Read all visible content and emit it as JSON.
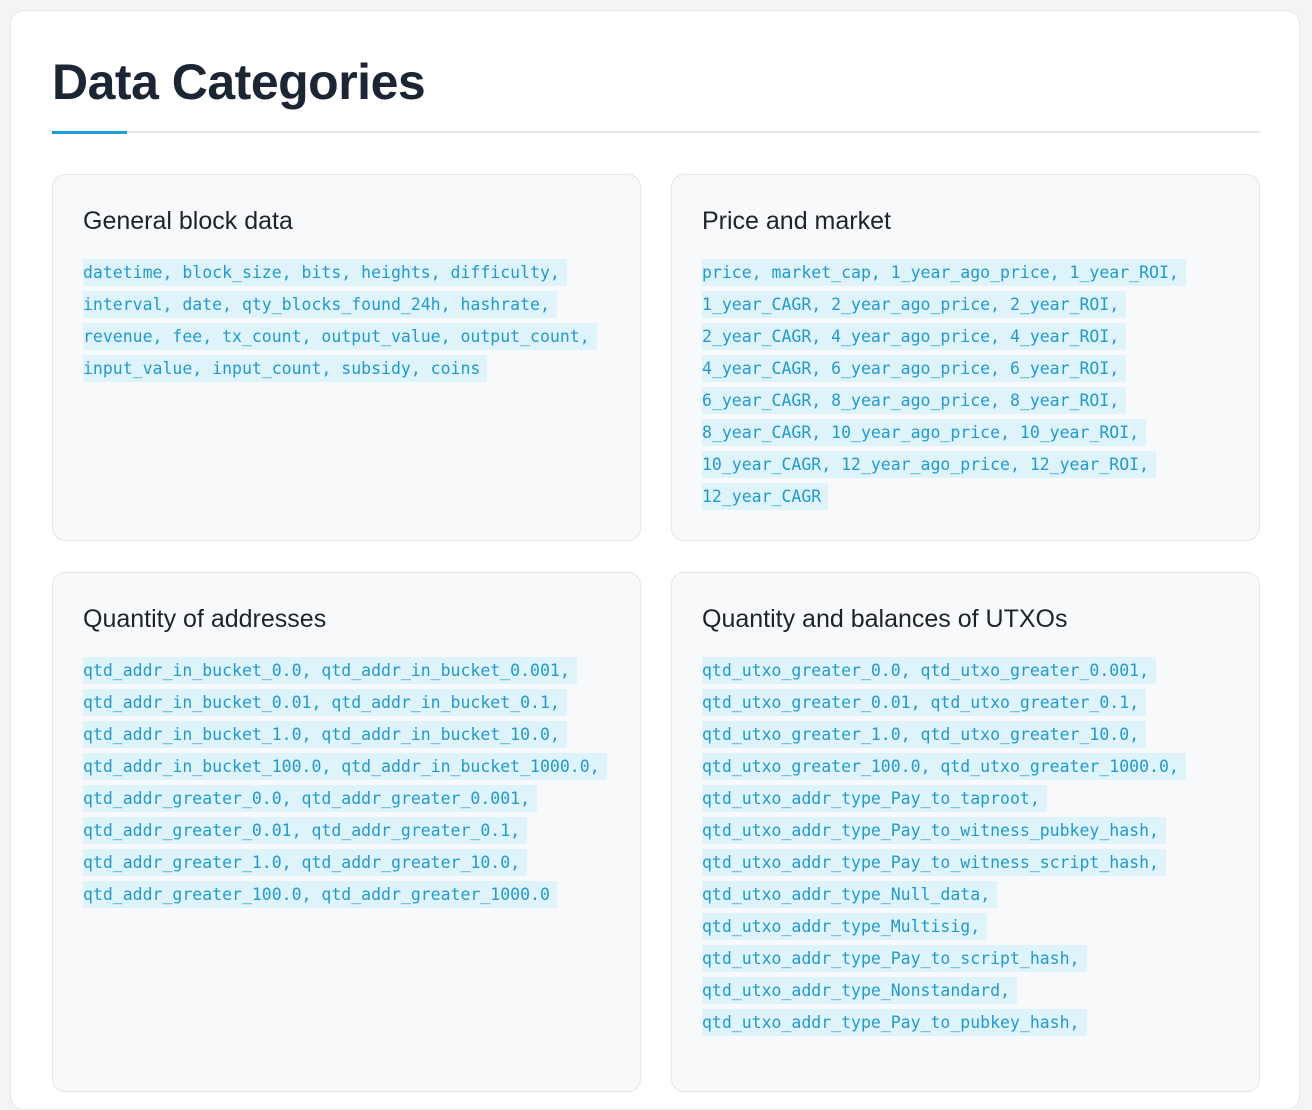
{
  "page": {
    "title": "Data Categories",
    "accent_color": "#1a9fde",
    "code_text_color": "#1f9bd0",
    "code_bg_color": "#def3fa"
  },
  "categories": [
    {
      "title": "General block data",
      "fields": " datetime, block_size, bits, heights, difficulty, interval, date, qty_blocks_found_24h, hashrate, revenue, fee, tx_count, output_value, output_count, input_value, input_count, subsidy, coins"
    },
    {
      "title": "Price and market",
      "fields": " price, market_cap, 1_year_ago_price, 1_year_ROI, 1_year_CAGR, 2_year_ago_price, 2_year_ROI, 2_year_CAGR, 4_year_ago_price, 4_year_ROI, 4_year_CAGR, 6_year_ago_price, 6_year_ROI, 6_year_CAGR, 8_year_ago_price, 8_year_ROI, 8_year_CAGR, 10_year_ago_price, 10_year_ROI, 10_year_CAGR, 12_year_ago_price, 12_year_ROI, 12_year_CAGR"
    },
    {
      "title": "Quantity of addresses",
      "fields": " qtd_addr_in_bucket_0.0, qtd_addr_in_bucket_0.001, qtd_addr_in_bucket_0.01, qtd_addr_in_bucket_0.1, qtd_addr_in_bucket_1.0, qtd_addr_in_bucket_10.0, qtd_addr_in_bucket_100.0, qtd_addr_in_bucket_1000.0, qtd_addr_greater_0.0, qtd_addr_greater_0.001, qtd_addr_greater_0.01, qtd_addr_greater_0.1, qtd_addr_greater_1.0, qtd_addr_greater_10.0, qtd_addr_greater_100.0, qtd_addr_greater_1000.0"
    },
    {
      "title": "Quantity and balances of UTXOs",
      "fields": " qtd_utxo_greater_0.0, qtd_utxo_greater_0.001, qtd_utxo_greater_0.01, qtd_utxo_greater_0.1, qtd_utxo_greater_1.0, qtd_utxo_greater_10.0, qtd_utxo_greater_100.0, qtd_utxo_greater_1000.0, qtd_utxo_addr_type_Pay_to_taproot, qtd_utxo_addr_type_Pay_to_witness_pubkey_hash, qtd_utxo_addr_type_Pay_to_witness_script_hash, qtd_utxo_addr_type_Null_data, qtd_utxo_addr_type_Multisig, qtd_utxo_addr_type_Pay_to_script_hash, qtd_utxo_addr_type_Nonstandard, qtd_utxo_addr_type_Pay_to_pubkey_hash,"
    }
  ]
}
